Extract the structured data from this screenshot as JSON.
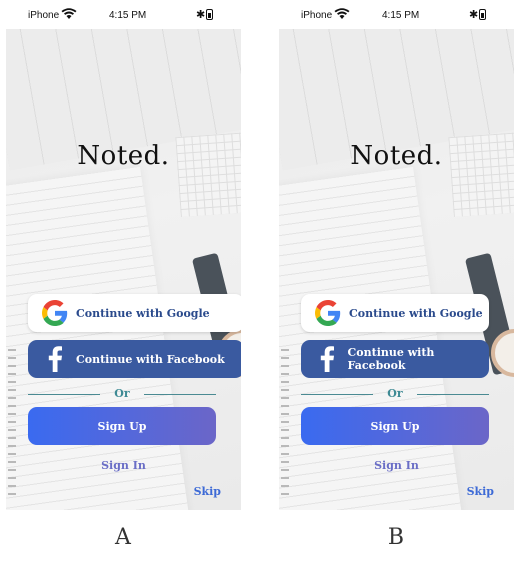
{
  "status_bar": {
    "carrier": "iPhone",
    "time": "4:15 PM"
  },
  "app": {
    "title": "Noted.",
    "google_button": "Continue with Google",
    "facebook_button": "Continue with Facebook",
    "or_text": "Or",
    "signup_button": "Sign Up",
    "signin_link": "Sign In",
    "skip_link": "Skip"
  },
  "captions": {
    "left": "A",
    "right": "B"
  },
  "colors": {
    "google_text": "#2a4a8c",
    "facebook_bg": "#3a5aa0",
    "signup_gradient_start": "#3a6af0",
    "signup_gradient_end": "#6b66c8",
    "divider": "#3e8a94",
    "signin": "#6a6ec6",
    "skip": "#3d6ad6"
  }
}
